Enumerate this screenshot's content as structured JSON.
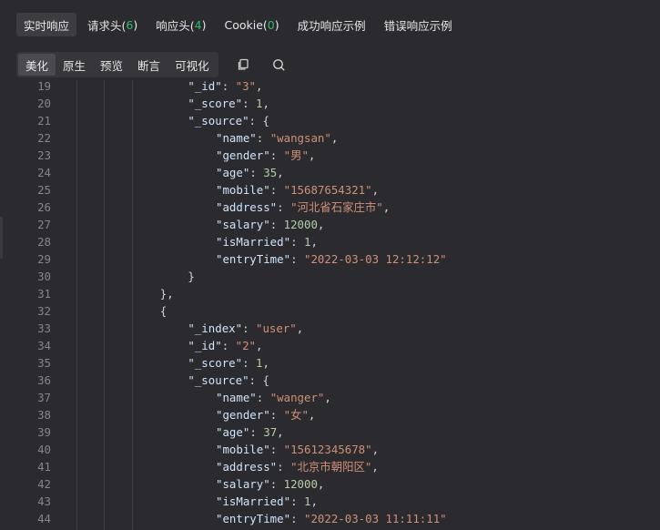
{
  "top_tabs": [
    {
      "label": "实时响应",
      "count": ""
    },
    {
      "label": "请求头(",
      "count": "6",
      "suffix": ")"
    },
    {
      "label": "响应头(",
      "count": "4",
      "suffix": ")"
    },
    {
      "label": "Cookie(",
      "count": "0",
      "suffix": ")"
    },
    {
      "label": "成功响应示例",
      "count": ""
    },
    {
      "label": "错误响应示例",
      "count": ""
    }
  ],
  "view_modes": [
    "美化",
    "原生",
    "预览",
    "断言",
    "可视化"
  ],
  "toolbar_icons": {
    "copy": "copy-icon",
    "search": "search-icon"
  },
  "colors": {
    "count_green": "#2ebd6b",
    "key": "#cfe3fa",
    "string": "#ce9178",
    "number": "#b5cea8"
  },
  "code_lines": [
    {
      "n": "19",
      "indent": 4,
      "tokens": [
        [
          "k",
          "\"_id\""
        ],
        [
          "p",
          ": "
        ],
        [
          "s",
          "\"3\""
        ],
        [
          "p",
          ","
        ]
      ]
    },
    {
      "n": "20",
      "indent": 4,
      "tokens": [
        [
          "k",
          "\"_score\""
        ],
        [
          "p",
          ": "
        ],
        [
          "n",
          "1"
        ],
        [
          "p",
          ","
        ]
      ]
    },
    {
      "n": "21",
      "indent": 4,
      "tokens": [
        [
          "k",
          "\"_source\""
        ],
        [
          "p",
          ": {"
        ]
      ]
    },
    {
      "n": "22",
      "indent": 5,
      "tokens": [
        [
          "k",
          "\"name\""
        ],
        [
          "p",
          ": "
        ],
        [
          "s",
          "\"wangsan\""
        ],
        [
          "p",
          ","
        ]
      ]
    },
    {
      "n": "23",
      "indent": 5,
      "tokens": [
        [
          "k",
          "\"gender\""
        ],
        [
          "p",
          ": "
        ],
        [
          "s",
          "\"男\""
        ],
        [
          "p",
          ","
        ]
      ]
    },
    {
      "n": "24",
      "indent": 5,
      "tokens": [
        [
          "k",
          "\"age\""
        ],
        [
          "p",
          ": "
        ],
        [
          "n",
          "35"
        ],
        [
          "p",
          ","
        ]
      ]
    },
    {
      "n": "25",
      "indent": 5,
      "tokens": [
        [
          "k",
          "\"mobile\""
        ],
        [
          "p",
          ": "
        ],
        [
          "s",
          "\"15687654321\""
        ],
        [
          "p",
          ","
        ]
      ]
    },
    {
      "n": "26",
      "indent": 5,
      "tokens": [
        [
          "k",
          "\"address\""
        ],
        [
          "p",
          ": "
        ],
        [
          "s",
          "\"河北省石家庄市\""
        ],
        [
          "p",
          ","
        ]
      ]
    },
    {
      "n": "27",
      "indent": 5,
      "tokens": [
        [
          "k",
          "\"salary\""
        ],
        [
          "p",
          ": "
        ],
        [
          "n",
          "12000"
        ],
        [
          "p",
          ","
        ]
      ]
    },
    {
      "n": "28",
      "indent": 5,
      "tokens": [
        [
          "k",
          "\"isMarried\""
        ],
        [
          "p",
          ": "
        ],
        [
          "n",
          "1"
        ],
        [
          "p",
          ","
        ]
      ]
    },
    {
      "n": "29",
      "indent": 5,
      "tokens": [
        [
          "k",
          "\"entryTime\""
        ],
        [
          "p",
          ": "
        ],
        [
          "s",
          "\"2022-03-03 12:12:12\""
        ]
      ]
    },
    {
      "n": "30",
      "indent": 4,
      "tokens": [
        [
          "p",
          "}"
        ]
      ]
    },
    {
      "n": "31",
      "indent": 3,
      "tokens": [
        [
          "p",
          "},"
        ]
      ]
    },
    {
      "n": "32",
      "indent": 3,
      "tokens": [
        [
          "p",
          "{"
        ]
      ]
    },
    {
      "n": "33",
      "indent": 4,
      "tokens": [
        [
          "k",
          "\"_index\""
        ],
        [
          "p",
          ": "
        ],
        [
          "s",
          "\"user\""
        ],
        [
          "p",
          ","
        ]
      ]
    },
    {
      "n": "34",
      "indent": 4,
      "tokens": [
        [
          "k",
          "\"_id\""
        ],
        [
          "p",
          ": "
        ],
        [
          "s",
          "\"2\""
        ],
        [
          "p",
          ","
        ]
      ]
    },
    {
      "n": "35",
      "indent": 4,
      "tokens": [
        [
          "k",
          "\"_score\""
        ],
        [
          "p",
          ": "
        ],
        [
          "n",
          "1"
        ],
        [
          "p",
          ","
        ]
      ]
    },
    {
      "n": "36",
      "indent": 4,
      "tokens": [
        [
          "k",
          "\"_source\""
        ],
        [
          "p",
          ": {"
        ]
      ]
    },
    {
      "n": "37",
      "indent": 5,
      "tokens": [
        [
          "k",
          "\"name\""
        ],
        [
          "p",
          ": "
        ],
        [
          "s",
          "\"wanger\""
        ],
        [
          "p",
          ","
        ]
      ]
    },
    {
      "n": "38",
      "indent": 5,
      "tokens": [
        [
          "k",
          "\"gender\""
        ],
        [
          "p",
          ": "
        ],
        [
          "s",
          "\"女\""
        ],
        [
          "p",
          ","
        ]
      ]
    },
    {
      "n": "39",
      "indent": 5,
      "tokens": [
        [
          "k",
          "\"age\""
        ],
        [
          "p",
          ": "
        ],
        [
          "n",
          "37"
        ],
        [
          "p",
          ","
        ]
      ]
    },
    {
      "n": "40",
      "indent": 5,
      "tokens": [
        [
          "k",
          "\"mobile\""
        ],
        [
          "p",
          ": "
        ],
        [
          "s",
          "\"15612345678\""
        ],
        [
          "p",
          ","
        ]
      ]
    },
    {
      "n": "41",
      "indent": 5,
      "tokens": [
        [
          "k",
          "\"address\""
        ],
        [
          "p",
          ": "
        ],
        [
          "s",
          "\"北京市朝阳区\""
        ],
        [
          "p",
          ","
        ]
      ]
    },
    {
      "n": "42",
      "indent": 5,
      "tokens": [
        [
          "k",
          "\"salary\""
        ],
        [
          "p",
          ": "
        ],
        [
          "n",
          "12000"
        ],
        [
          "p",
          ","
        ]
      ]
    },
    {
      "n": "43",
      "indent": 5,
      "tokens": [
        [
          "k",
          "\"isMarried\""
        ],
        [
          "p",
          ": "
        ],
        [
          "n",
          "1"
        ],
        [
          "p",
          ","
        ]
      ]
    },
    {
      "n": "44",
      "indent": 5,
      "tokens": [
        [
          "k",
          "\"entryTime\""
        ],
        [
          "p",
          ": "
        ],
        [
          "s",
          "\"2022-03-03 11:11:11\""
        ]
      ]
    }
  ]
}
